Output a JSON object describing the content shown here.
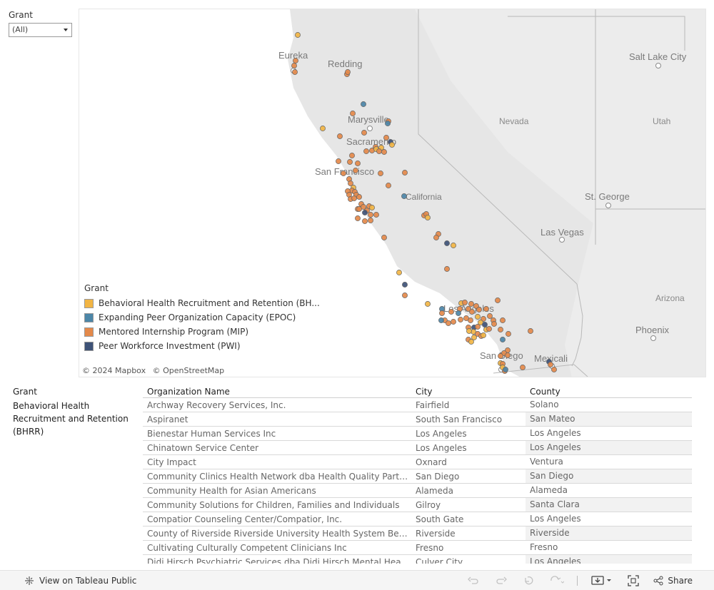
{
  "filter": {
    "title": "Grant",
    "selected": "(All)"
  },
  "map": {
    "cities": [
      {
        "name": "Eureka"
      },
      {
        "name": "Redding"
      },
      {
        "name": "Marysville"
      },
      {
        "name": "Sacramento"
      },
      {
        "name": "San Francisco"
      },
      {
        "name": "California"
      },
      {
        "name": "Nevada"
      },
      {
        "name": "Utah"
      },
      {
        "name": "Salt Lake City"
      },
      {
        "name": "St. George"
      },
      {
        "name": "Las Vegas"
      },
      {
        "name": "Arizona"
      },
      {
        "name": "Phoenix"
      },
      {
        "name": "Los Angeles"
      },
      {
        "name": "San Diego"
      },
      {
        "name": "Mexicali"
      }
    ],
    "legend": {
      "title": "Grant",
      "items": [
        {
          "label": "Behavioral Health Recruitment and Retention (BH...",
          "color": "#f2b544"
        },
        {
          "label": "Expanding Peer Organization Capacity (EPOC)",
          "color": "#4c86a8"
        },
        {
          "label": "Mentored Internship Program (MIP)",
          "color": "#e4894a"
        },
        {
          "label": "Peer Workforce Investment (PWI)",
          "color": "#3e5378"
        }
      ]
    },
    "attribution": [
      "© 2024 Mapbox",
      "© OpenStreetMap"
    ]
  },
  "table": {
    "headers": {
      "grant": "Grant",
      "org": "Organization Name",
      "city": "City",
      "county": "County"
    },
    "group": "Behavioral Health Recruitment and Retention (BHRR)",
    "rows": [
      {
        "org": "Archway Recovery Services, Inc.",
        "city": "Fairfield",
        "county": "Solano"
      },
      {
        "org": "Aspiranet",
        "city": "South San Francisco",
        "county": "San Mateo"
      },
      {
        "org": "Bienestar Human Services Inc",
        "city": "Los Angeles",
        "county": "Los Angeles"
      },
      {
        "org": "Chinatown Service Center",
        "city": "Los Angeles",
        "county": "Los Angeles"
      },
      {
        "org": "City Impact",
        "city": "Oxnard",
        "county": "Ventura"
      },
      {
        "org": "Community Clinics Health Network dba Health Quality Partners ..",
        "city": "San Diego",
        "county": "San Diego"
      },
      {
        "org": "Community Health for Asian Americans",
        "city": "Alameda",
        "county": "Alameda"
      },
      {
        "org": "Community Solutions for Children, Families and Individuals",
        "city": "Gilroy",
        "county": "Santa Clara"
      },
      {
        "org": "Compatior Counseling Center/Compatior, Inc.",
        "city": "South Gate",
        "county": "Los Angeles"
      },
      {
        "org": "County of Riverside Riverside University Health System Behavio..",
        "city": "Riverside",
        "county": "Riverside"
      },
      {
        "org": "Cultivating Culturally Competent Clinicians Inc",
        "city": "Fresno",
        "county": "Fresno"
      },
      {
        "org": "Didi Hirsch Psychiatric Services dba Didi Hirsch Mental Health S..",
        "city": "Culver City",
        "county": "Los Angeles"
      }
    ]
  },
  "footer": {
    "view_label": "View on Tableau Public",
    "share_label": "Share"
  }
}
